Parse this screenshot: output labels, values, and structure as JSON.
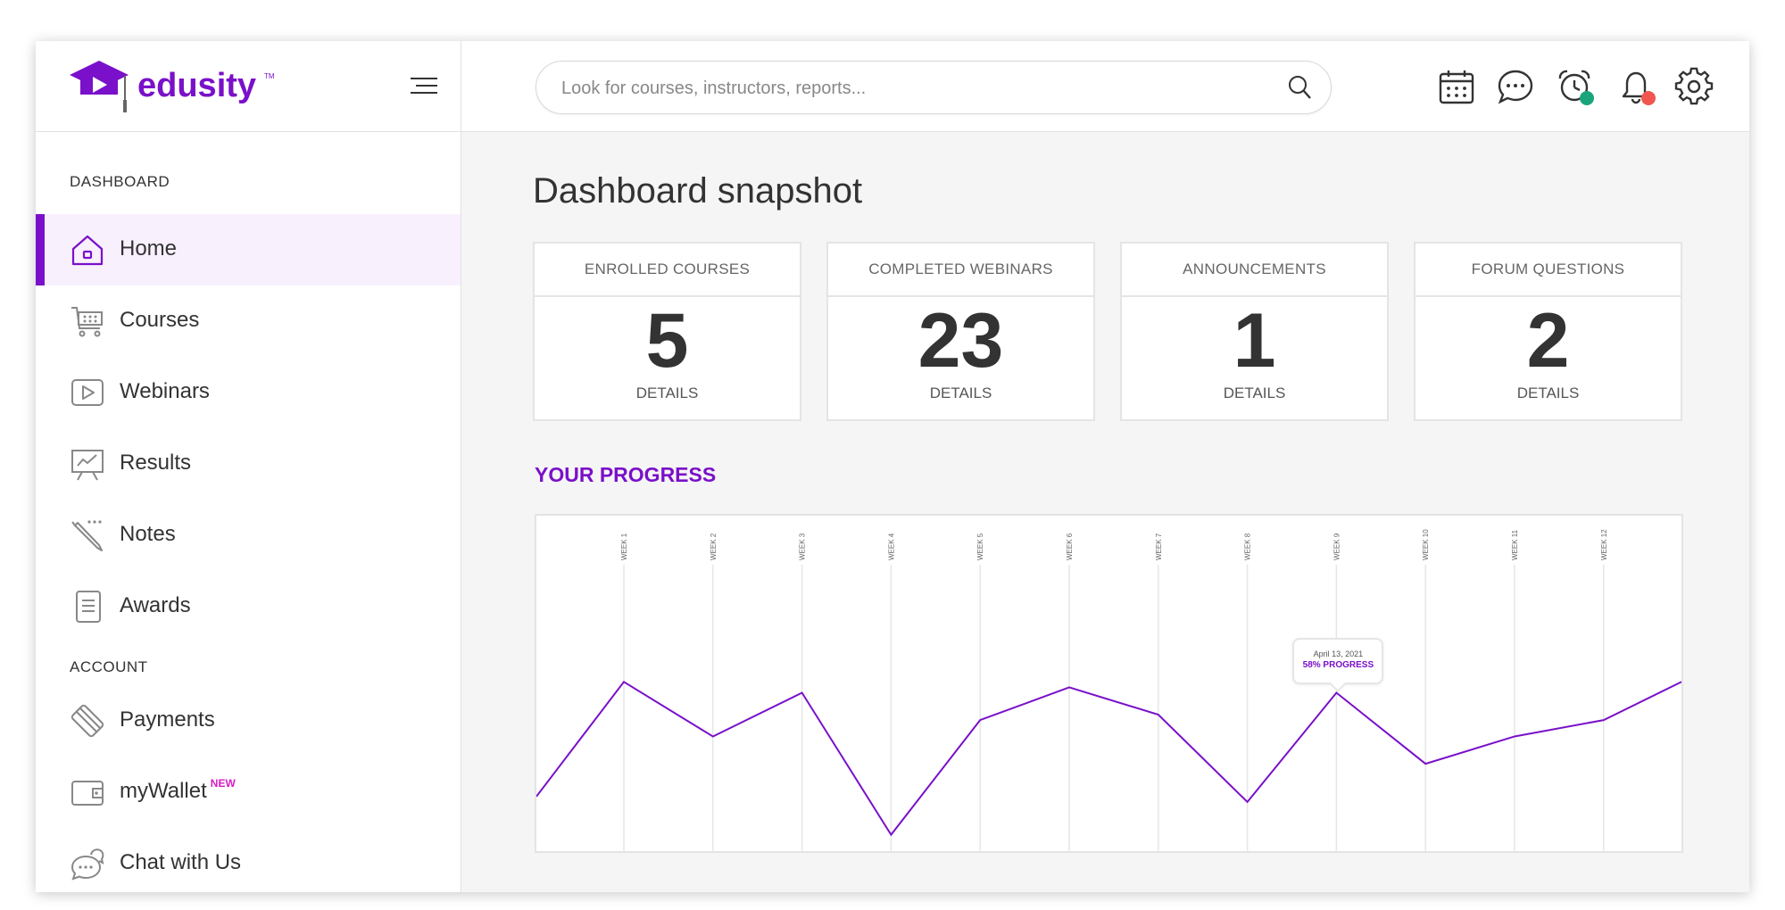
{
  "brand": {
    "name": "edusity",
    "tm": "TM"
  },
  "header": {
    "search_placeholder": "Look for courses, instructors, reports...",
    "icons": [
      "calendar-icon",
      "chat-bubble-icon",
      "alarm-clock-icon",
      "bell-icon",
      "gear-icon"
    ],
    "status_colors": {
      "alarm_dot": "#1aa47b",
      "bell_dot": "#f0564f"
    }
  },
  "sidebar": {
    "section_dashboard": "DASHBOARD",
    "section_account": "ACCOUNT",
    "items": [
      {
        "label": "Home",
        "icon": "home-icon",
        "active": true
      },
      {
        "label": "Courses",
        "icon": "cart-icon"
      },
      {
        "label": "Webinars",
        "icon": "video-play-icon"
      },
      {
        "label": "Results",
        "icon": "presentation-chart-icon"
      },
      {
        "label": "Notes",
        "icon": "pencil-icon"
      },
      {
        "label": "Awards",
        "icon": "document-icon"
      }
    ],
    "account_items": [
      {
        "label": "Payments",
        "icon": "credit-card-icon"
      },
      {
        "label": "myWallet",
        "badge": "NEW",
        "icon": "wallet-icon"
      },
      {
        "label": "Chat with Us",
        "icon": "chat-icon"
      }
    ]
  },
  "main": {
    "title": "Dashboard snapshot",
    "cards": [
      {
        "title": "ENROLLED COURSES",
        "value": "5",
        "link": "DETAILS"
      },
      {
        "title": "COMPLETED WEBINARS",
        "value": "23",
        "link": "DETAILS"
      },
      {
        "title": "ANNOUNCEMENTS",
        "value": "1",
        "link": "DETAILS"
      },
      {
        "title": "FORUM QUESTIONS",
        "value": "2",
        "link": "DETAILS"
      }
    ],
    "progress_title": "YOUR PROGRESS",
    "tooltip": {
      "date": "April 13, 2021",
      "value": "58% PROGRESS"
    }
  },
  "colors": {
    "accent": "#7a10c9",
    "new_badge": "#d61ec5"
  },
  "chart_data": {
    "type": "line",
    "categories": [
      "WEEK 1",
      "WEEK 2",
      "WEEK 3",
      "WEEK 4",
      "WEEK 5",
      "WEEK 6",
      "WEEK 7",
      "WEEK 8",
      "WEEK 9",
      "WEEK 10",
      "WEEK 11",
      "WEEK 12"
    ],
    "series": [
      {
        "values": [
          62,
          42,
          58,
          6,
          48,
          60,
          50,
          18,
          58,
          32,
          42,
          48
        ]
      }
    ],
    "line_start_value": 20,
    "line_end_value": 62,
    "ylim": [
      0,
      100
    ],
    "highlight": {
      "category": "WEEK 9",
      "date": "April 13, 2021",
      "label": "58% PROGRESS"
    },
    "grid": "vertical"
  }
}
